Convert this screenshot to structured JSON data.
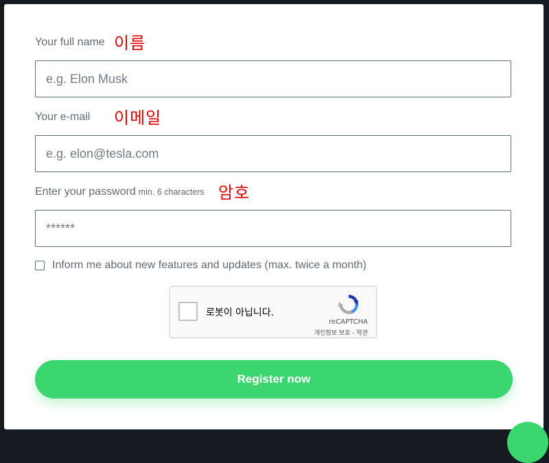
{
  "form": {
    "name_label": "Your full name",
    "name_placeholder": "e.g. Elon Musk",
    "email_label": "Your e-mail",
    "email_placeholder": "e.g. elon@tesla.com",
    "password_label": "Enter your password",
    "password_hint": "min. 6 characters",
    "password_placeholder": "******",
    "newsletter_label": "Inform me about new features and updates (max. twice a month)",
    "submit_label": "Register now"
  },
  "annotations": {
    "name": "이름",
    "email": "이메일",
    "password": "암호"
  },
  "recaptcha": {
    "text": "로봇이 아닙니다.",
    "brand": "reCAPTCHA",
    "links": "개인정보 보호 - 약관"
  },
  "colors": {
    "accent": "#3bd66f",
    "annotation": "#e00000",
    "background": "#161b22"
  }
}
